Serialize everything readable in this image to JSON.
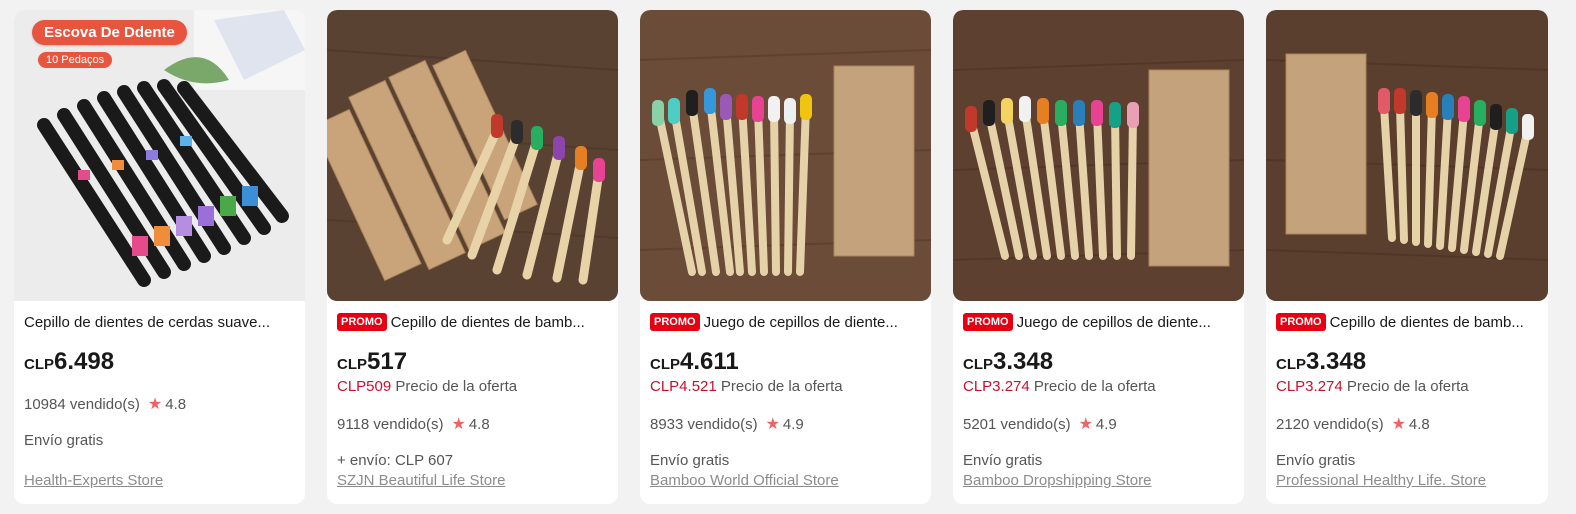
{
  "products": [
    {
      "title": "Cepillo de dientes de cerdas suave...",
      "promo": "",
      "currency": "CLP",
      "price": "6.498",
      "offer_price": "",
      "offer_label": "",
      "sold": "10984 vendido(s)",
      "rating": "4.8",
      "shipping": "Envío gratis",
      "store": "Health-Experts Store",
      "image_badge": "Escova De Ddente",
      "image_badge_sub": "10 Pedaços"
    },
    {
      "title": "Cepillo de dientes de bamb...",
      "promo": "PROMO",
      "currency": "CLP",
      "price": "517",
      "offer_price": "CLP509",
      "offer_label": "Precio de la oferta",
      "sold": "9118 vendido(s)",
      "rating": "4.8",
      "shipping": "+ envío: CLP 607",
      "store": "SZJN Beautiful Life Store"
    },
    {
      "title": "Juego de cepillos de diente...",
      "promo": "PROMO",
      "currency": "CLP",
      "price": "4.611",
      "offer_price": "CLP4.521",
      "offer_label": "Precio de la oferta",
      "sold": "8933 vendido(s)",
      "rating": "4.9",
      "shipping": "Envío gratis",
      "store": "Bamboo World Official Store"
    },
    {
      "title": "Juego de cepillos de diente...",
      "promo": "PROMO",
      "currency": "CLP",
      "price": "3.348",
      "offer_price": "CLP3.274",
      "offer_label": "Precio de la oferta",
      "sold": "5201 vendido(s)",
      "rating": "4.9",
      "shipping": "Envío gratis",
      "store": "Bamboo Dropshipping Store"
    },
    {
      "title": "Cepillo de dientes de bamb...",
      "promo": "PROMO",
      "currency": "CLP",
      "price": "3.348",
      "offer_price": "CLP3.274",
      "offer_label": "Precio de la oferta",
      "sold": "2120 vendido(s)",
      "rating": "4.8",
      "shipping": "Envío gratis",
      "store": "Professional Healthy Life. Store"
    }
  ],
  "colors": {
    "promo_bg": "#e60012",
    "offer_price": "#c8102e",
    "star": "#f06266",
    "store_link": "#8c8c8c"
  },
  "icons": {
    "rating": "star-icon"
  }
}
